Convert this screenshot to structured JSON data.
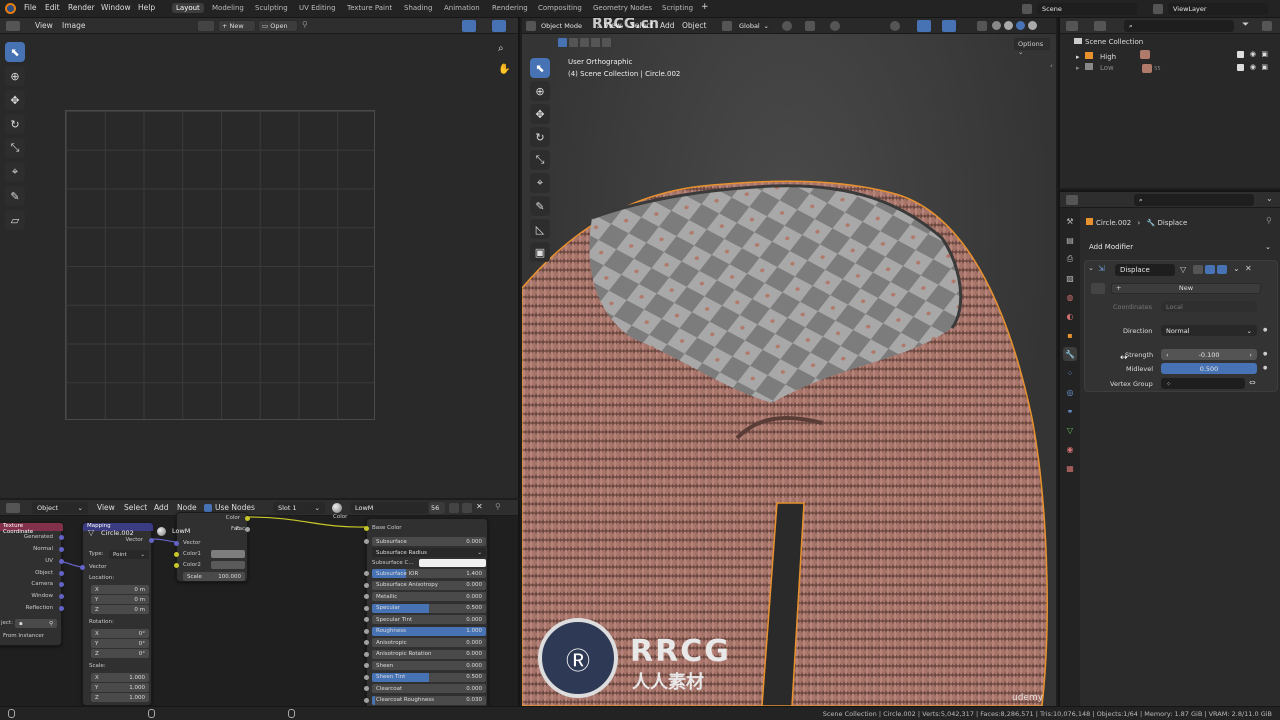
{
  "topbar": {
    "menus": [
      "File",
      "Edit",
      "Render",
      "Window",
      "Help"
    ],
    "workspaces": [
      "Layout",
      "Modeling",
      "Sculpting",
      "UV Editing",
      "Texture Paint",
      "Shading",
      "Animation",
      "Rendering",
      "Compositing",
      "Geometry Nodes",
      "Scripting"
    ],
    "active_workspace": "Layout",
    "add_tab": "+",
    "scene": "Scene",
    "view_layer": "ViewLayer"
  },
  "image_editor": {
    "menus": [
      "View",
      "Image"
    ],
    "new_label": "New",
    "open_label": "Open"
  },
  "viewport": {
    "mode": "Object Mode",
    "menus": [
      "View",
      "Select",
      "Add",
      "Object"
    ],
    "orientation": "Global",
    "options": "Options",
    "overlay_title": "User Orthographic",
    "overlay_subtitle": "(4) Scene Collection | Circle.002"
  },
  "outliner": {
    "root": "Scene Collection",
    "items": [
      {
        "name": "High"
      },
      {
        "name": "Low",
        "badge": "55"
      }
    ]
  },
  "properties": {
    "object": "Circle.002",
    "modifier_breadcrumb": "Displace",
    "add_modifier": "Add Modifier",
    "modifier_name": "Displace",
    "new_label": "New",
    "coordinates_label": "Coordinates",
    "coordinates_value": "Local",
    "direction_label": "Direction",
    "direction_value": "Normal",
    "strength_label": "Strength",
    "strength_value": "-0.100",
    "midlevel_label": "Midlevel",
    "midlevel_value": "0.500",
    "vertex_group_label": "Vertex Group"
  },
  "node_editor": {
    "editor_type": "Object",
    "menus": [
      "View",
      "Select",
      "Add",
      "Node"
    ],
    "use_nodes": "Use Nodes",
    "slot": "Slot 1",
    "material": "LowM",
    "users": "56"
  },
  "nodes": {
    "texcoord": {
      "title": "Texture Coordinate",
      "outputs": [
        "Generated",
        "Normal",
        "UV",
        "Object",
        "Camera",
        "Window",
        "Reflection"
      ],
      "object_label": "ject:",
      "from_instancer": "From Instancer"
    },
    "mapping": {
      "title": "Mapping",
      "obj": "Circle.002",
      "vector_out": "Vector",
      "type_label": "Type:",
      "type_value": "Point",
      "vector_in": "Vector",
      "location": "Location:",
      "loc": [
        [
          "X",
          "0 m"
        ],
        [
          "Y",
          "0 m"
        ],
        [
          "Z",
          "0 m"
        ]
      ],
      "rotation": "Rotation:",
      "rot": [
        [
          "X",
          "0°"
        ],
        [
          "Y",
          "0°"
        ],
        [
          "Z",
          "0°"
        ]
      ],
      "scale": "Scale:",
      "scl": [
        [
          "X",
          "1.000"
        ],
        [
          "Y",
          "1.000"
        ],
        [
          "Z",
          "1.000"
        ]
      ]
    },
    "checker": {
      "title": "LowM",
      "color_out": "Color",
      "fac_out": "Fac",
      "vector": "Vector",
      "color1": "Color1",
      "color2": "Color2",
      "scale_label": "Scale",
      "scale_value": "100.000"
    },
    "bsdf": {
      "base_color": "Base Color",
      "subsurface_radius": "Subsurface Radius",
      "subsurface_color": "Subsurface C...",
      "rows": [
        {
          "label": "Subsurface",
          "value": "0.000",
          "fill": 0
        },
        {
          "label": "Subsurface IOR",
          "value": "1.400",
          "fill": 0.3
        },
        {
          "label": "Subsurface Anisotropy",
          "value": "0.000",
          "fill": 0
        },
        {
          "label": "Metallic",
          "value": "0.000",
          "fill": 0
        },
        {
          "label": "Specular",
          "value": "0.500",
          "fill": 0.5
        },
        {
          "label": "Specular Tint",
          "value": "0.000",
          "fill": 0
        },
        {
          "label": "Roughness",
          "value": "1.000",
          "fill": 1
        },
        {
          "label": "Anisotropic",
          "value": "0.000",
          "fill": 0
        },
        {
          "label": "Anisotropic Rotation",
          "value": "0.000",
          "fill": 0
        },
        {
          "label": "Sheen",
          "value": "0.000",
          "fill": 0
        },
        {
          "label": "Sheen Tint",
          "value": "0.500",
          "fill": 0.5
        },
        {
          "label": "Clearcoat",
          "value": "0.000",
          "fill": 0
        },
        {
          "label": "Clearcoat Roughness",
          "value": "0.030",
          "fill": 0.03
        }
      ]
    },
    "color_in": "Color",
    "fac_in": "Fac"
  },
  "statusbar": {
    "text": "Scene Collection | Circle.002 | Verts:5,042,317 | Faces:8,286,571 | Tris:10,076,148 | Objects:1/64 | Memory: 1.87 GiB | VRAM: 2.8/11.0 GiB"
  },
  "watermarks": {
    "top": "RRCG.cn",
    "logo_big": "RRCG",
    "logo_small": "人人素材",
    "udemy": "udemy"
  },
  "colors": {
    "accent": "#4772b3",
    "selection_orange": "#e8922e",
    "knit": "#b07a6a"
  }
}
